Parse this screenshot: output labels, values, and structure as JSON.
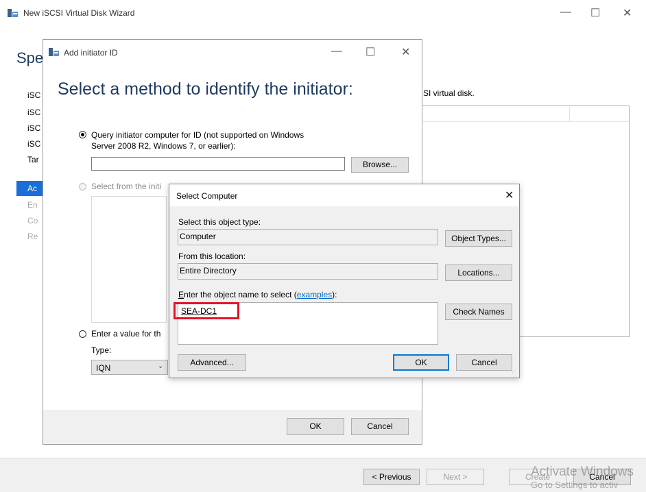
{
  "main_window": {
    "title": "New iSCSI Virtual Disk Wizard",
    "heading": "Spe",
    "description_tail": "SI virtual disk.",
    "sidebar": [
      {
        "label": "iSC",
        "active": false,
        "dim": false
      },
      {
        "label": "iSC",
        "active": false,
        "dim": false
      },
      {
        "label": "iSC",
        "active": false,
        "dim": false
      },
      {
        "label": "iSC",
        "active": false,
        "dim": false
      },
      {
        "label": "Tar",
        "active": false,
        "dim": false
      },
      {
        "label": "Ac",
        "active": true,
        "dim": false
      },
      {
        "label": "En",
        "active": false,
        "dim": true
      },
      {
        "label": "Co",
        "active": false,
        "dim": true
      },
      {
        "label": "Re",
        "active": false,
        "dim": true
      }
    ],
    "buttons": {
      "previous": "< Previous",
      "next": "Next >",
      "create": "Create",
      "cancel": "Cancel"
    },
    "watermark": {
      "line1": "Activate Windows",
      "line2": "Go to Settings to activ"
    }
  },
  "initiator_dialog": {
    "title": "Add initiator ID",
    "heading": "Select a method to identify the initiator:",
    "option_query": {
      "line1": "Query initiator computer for ID (not supported on Windows",
      "line2": "Server 2008 R2, Windows 7, or earlier):",
      "value": "",
      "selected": true
    },
    "browse_label": "Browse...",
    "option_select": {
      "label": "Select from the initi",
      "selected": false
    },
    "option_enter": {
      "label": "Enter a value for th",
      "selected": false
    },
    "type_label": "Type:",
    "type_value": "IQN",
    "ok_label": "OK",
    "cancel_label": "Cancel"
  },
  "select_computer": {
    "title": "Select Computer",
    "object_type_label": "Select this object type:",
    "object_type_value": "Computer",
    "object_types_button": "Object Types...",
    "location_label": "From this location:",
    "location_value": "Entire Directory",
    "locations_button": "Locations...",
    "name_label_pre": "nter the object name to select (",
    "name_label_underlined": "E",
    "name_label_link": "examples",
    "name_label_post": "):",
    "name_value": "SEA-DC1",
    "check_names_button": "Check Names",
    "advanced_button": "Advanced...",
    "ok_button": "OK",
    "cancel_button": "Cancel",
    "highlight_color": "#e81123"
  },
  "icons": {
    "app_icon": "server-disk-icon",
    "minimize": "minimize-icon",
    "maximize": "maximize-icon",
    "close": "close-icon",
    "dropdown": "chevron-down-icon",
    "resize": "resize-grip-icon"
  }
}
